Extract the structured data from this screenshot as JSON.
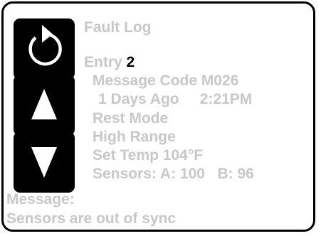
{
  "screen": {
    "title": "Fault Log",
    "entry_label": "Entry",
    "entry_number": "2",
    "message_code": "Message Code M026",
    "when": "1 Days Ago     2:21PM",
    "mode": "Rest Mode",
    "range": "High Range",
    "set_temp": "Set Temp 104°F",
    "sensors": "Sensors: A: 100   B: 96",
    "message_label": "Message:",
    "message_text": "Sensors are out of sync"
  },
  "buttons": {
    "back_icon": "back-arrow-icon",
    "up_icon": "up-triangle-icon",
    "down_icon": "down-triangle-icon"
  },
  "colors": {
    "text_dim": "#c8c8c8",
    "highlight": "#000000",
    "button_bg": "#000000",
    "icon": "#ffffff"
  }
}
